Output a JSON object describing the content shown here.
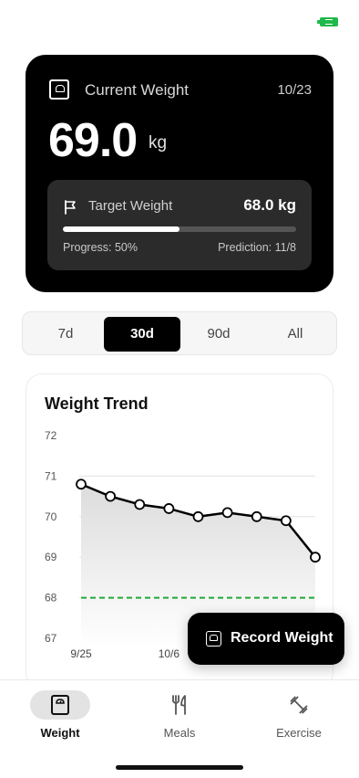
{
  "current": {
    "label": "Current Weight",
    "date": "10/23",
    "value": "69.0",
    "unit": "kg"
  },
  "target": {
    "label": "Target Weight",
    "value": "68.0 kg",
    "progress_text": "Progress: 50%",
    "prediction_text": "Prediction: 11/8",
    "progress_fraction": 0.5
  },
  "ranges": {
    "items": [
      "7d",
      "30d",
      "90d",
      "All"
    ],
    "active": "30d"
  },
  "trend": {
    "title": "Weight Trend"
  },
  "chart_data": {
    "type": "line",
    "title": "Weight Trend",
    "ylim": [
      67,
      72
    ],
    "yticks": [
      "72",
      "71",
      "70",
      "69",
      "68",
      "67"
    ],
    "xtick_labels": [
      "9/25",
      "10/6"
    ],
    "series": [
      {
        "values": [
          70.8,
          70.5,
          70.3,
          70.2,
          70.0,
          70.1,
          70.0,
          69.9,
          69.0
        ]
      }
    ],
    "target_line": 68.0,
    "grid": true,
    "colors": {
      "line": "#000000",
      "target": "#22a83a",
      "fill": "#dcdcdc"
    }
  },
  "record_button": {
    "label": "Record Weight",
    "icon": "scale-icon"
  },
  "nav": {
    "items": [
      {
        "label": "Weight",
        "icon": "scale-icon",
        "active": true
      },
      {
        "label": "Meals",
        "icon": "fork-knife-icon",
        "active": false
      },
      {
        "label": "Exercise",
        "icon": "dumbbell-icon",
        "active": false
      }
    ]
  },
  "colors": {
    "accent": "#000000",
    "battery": "#1fb84a",
    "target_dashed": "#22a83a"
  }
}
